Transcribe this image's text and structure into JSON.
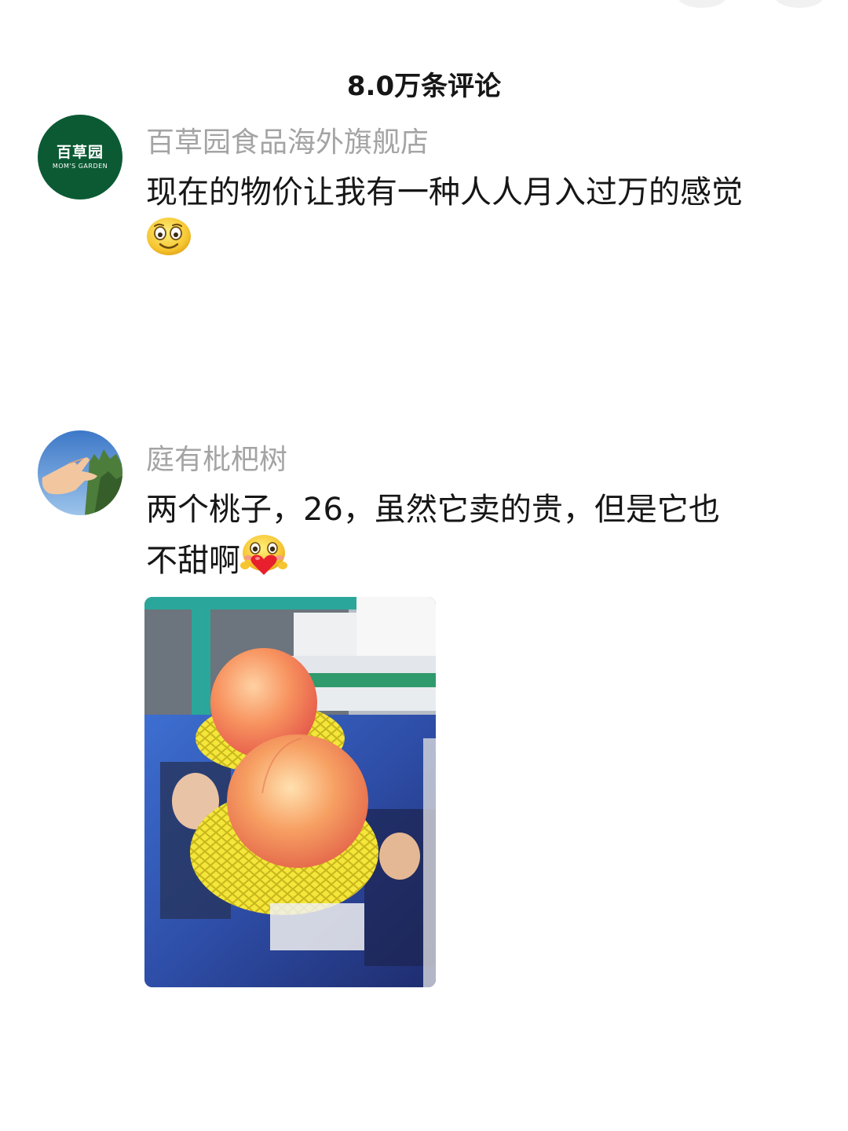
{
  "header": {
    "title": "8.0万条评论"
  },
  "comments": [
    {
      "username": "百草园食品海外旗舰店",
      "avatar": {
        "type": "brand-logo",
        "brand_cn": "百草园",
        "brand_en": "MOM'S GARDEN",
        "color": "#0b5a33"
      },
      "text": "现在的物价让我有一种人人月入过万的感觉",
      "emoji": "laughing-face-emoji"
    },
    {
      "username": "庭有枇杷树",
      "avatar": {
        "type": "photo",
        "description_icon": "hand-gesture-photo"
      },
      "text_line1": "两个桃子，26，虽然它卖的贵，但是它也",
      "text_line2": "不甜啊",
      "emoji": "heart-face-emoji",
      "attachment": {
        "type": "photo",
        "icon": "peaches-photo"
      }
    }
  ],
  "colors": {
    "text": "#161616",
    "username": "#a4a4a4",
    "background": "#ffffff",
    "brand_green": "#0b5a33"
  }
}
